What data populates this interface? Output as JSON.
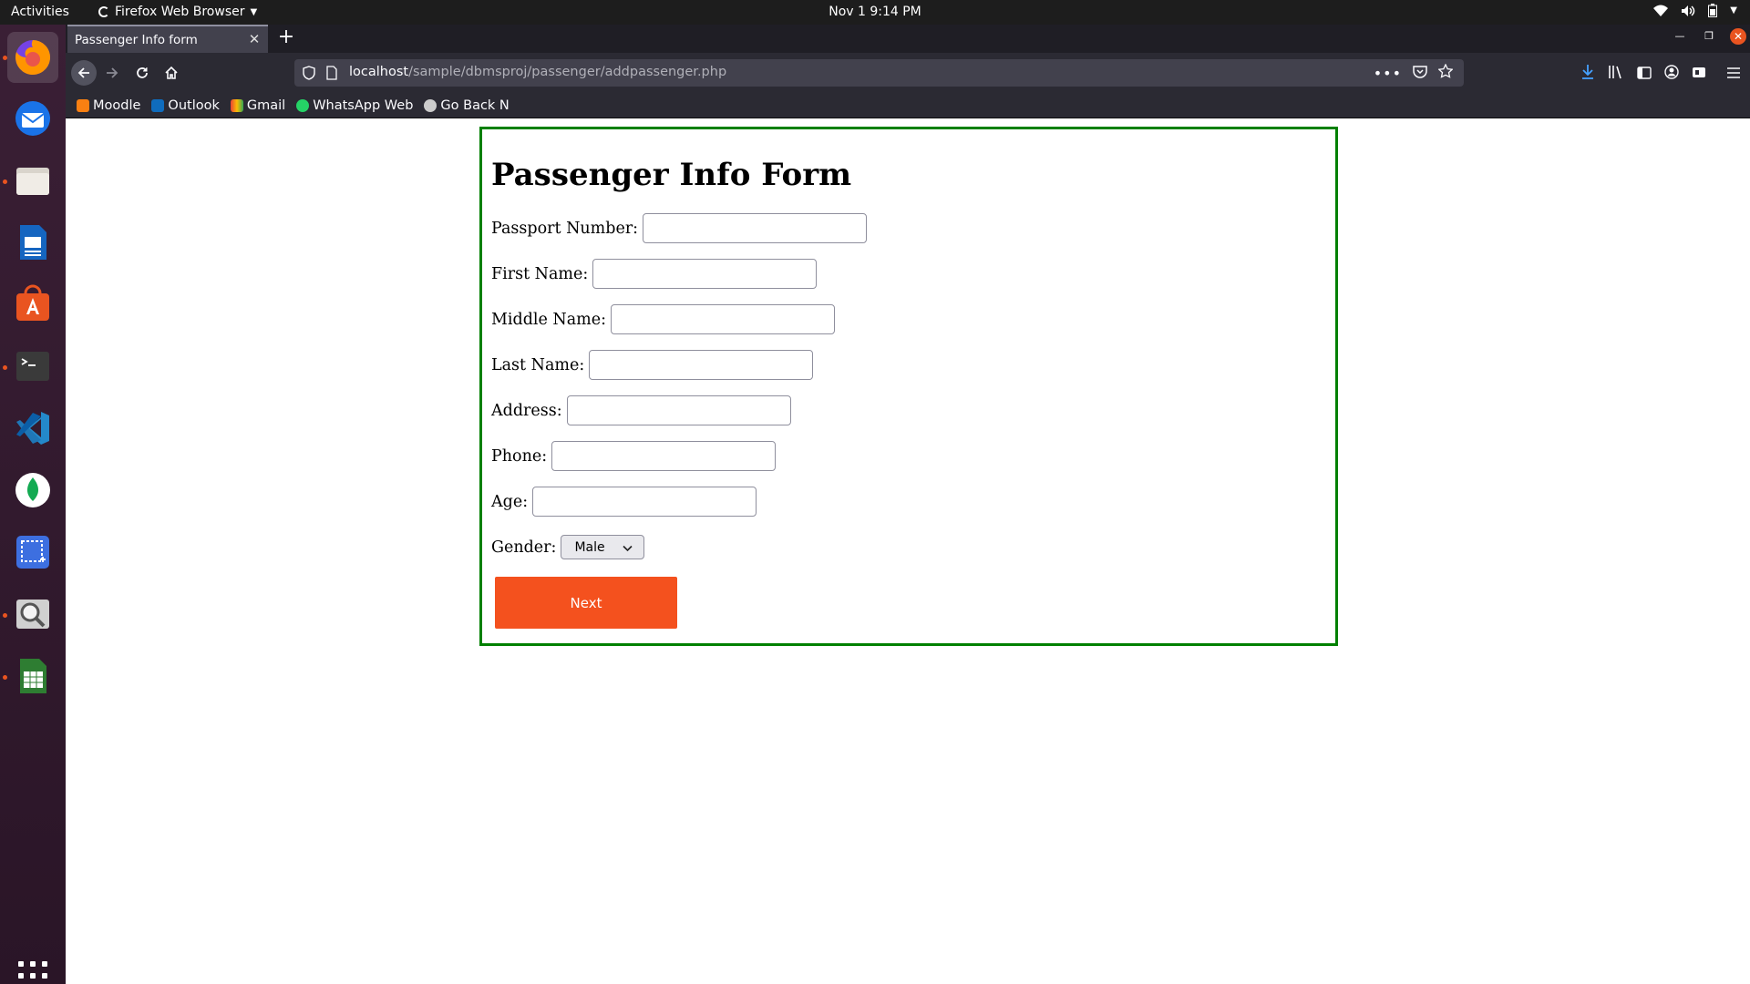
{
  "topbar": {
    "activities": "Activities",
    "app_name": "Firefox Web Browser",
    "clock": "Nov 1  9:14 PM"
  },
  "dock": {
    "items": [
      "firefox-icon",
      "thunderbird-icon",
      "files-icon",
      "writer-icon",
      "software-icon",
      "terminal-icon",
      "vscode-icon",
      "mongodb-icon",
      "screenshot-icon",
      "image-viewer-icon",
      "calc-icon"
    ],
    "show_apps": "app-grid-icon"
  },
  "browser": {
    "tab_title": "Passenger Info form",
    "url_host": "localhost",
    "url_path": "/sample/dbmsproj/passenger/addpassenger.php",
    "bookmarks": [
      {
        "label": "Moodle",
        "color": "#f98012"
      },
      {
        "label": "Outlook",
        "color": "#0f6cbd"
      },
      {
        "label": "Gmail",
        "color": "#ea4335"
      },
      {
        "label": "WhatsApp Web",
        "color": "#25d366"
      },
      {
        "label": "Go Back N",
        "color": "#cccccc"
      }
    ]
  },
  "form": {
    "title": "Passenger Info Form",
    "fields": {
      "passport": {
        "label": "Passport Number:",
        "value": ""
      },
      "first_name": {
        "label": "First Name:",
        "value": ""
      },
      "middle_name": {
        "label": "Middle Name:",
        "value": ""
      },
      "last_name": {
        "label": "Last Name:",
        "value": ""
      },
      "address": {
        "label": "Address:",
        "value": ""
      },
      "phone": {
        "label": "Phone:",
        "value": ""
      },
      "age": {
        "label": "Age:",
        "value": ""
      }
    },
    "gender": {
      "label": "Gender:",
      "selected": "Male"
    },
    "next_label": "Next",
    "border_color": "#008000",
    "button_color": "#f4511e"
  }
}
